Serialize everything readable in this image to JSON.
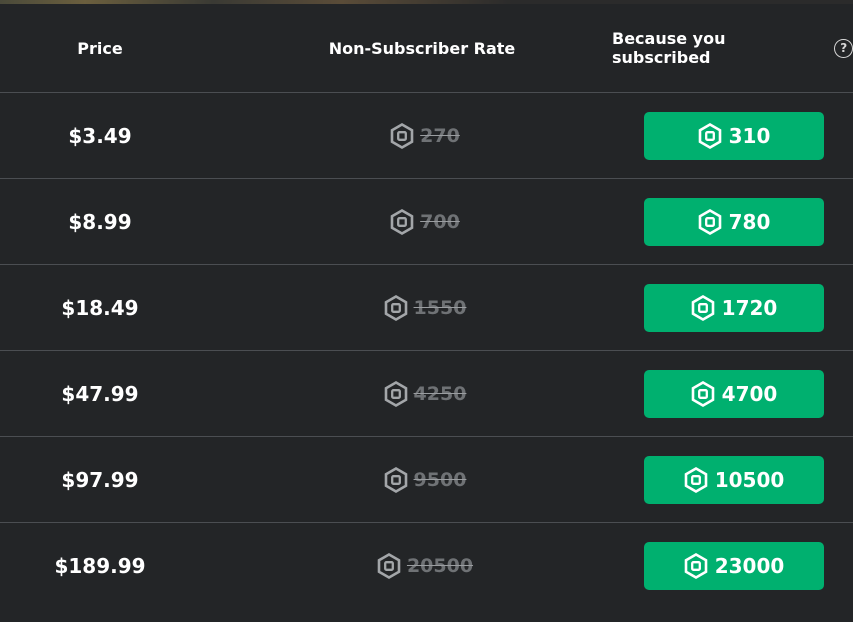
{
  "header": {
    "price_label": "Price",
    "rate_label": "Non-Subscriber Rate",
    "subscribed_label": "Because you subscribed",
    "help_icon": "?"
  },
  "colors": {
    "background": "#232527",
    "divider": "#4b4e52",
    "button_green": "#00b06f",
    "strike_gray": "#6f7275"
  },
  "icons": {
    "currency": "robux-icon",
    "help": "help-circle-icon"
  },
  "rows": [
    {
      "price": "$3.49",
      "non_subscriber": "270",
      "subscribed": "310"
    },
    {
      "price": "$8.99",
      "non_subscriber": "700",
      "subscribed": "780"
    },
    {
      "price": "$18.49",
      "non_subscriber": "1550",
      "subscribed": "1720"
    },
    {
      "price": "$47.99",
      "non_subscriber": "4250",
      "subscribed": "4700"
    },
    {
      "price": "$97.99",
      "non_subscriber": "9500",
      "subscribed": "10500"
    },
    {
      "price": "$189.99",
      "non_subscriber": "20500",
      "subscribed": "23000"
    }
  ]
}
